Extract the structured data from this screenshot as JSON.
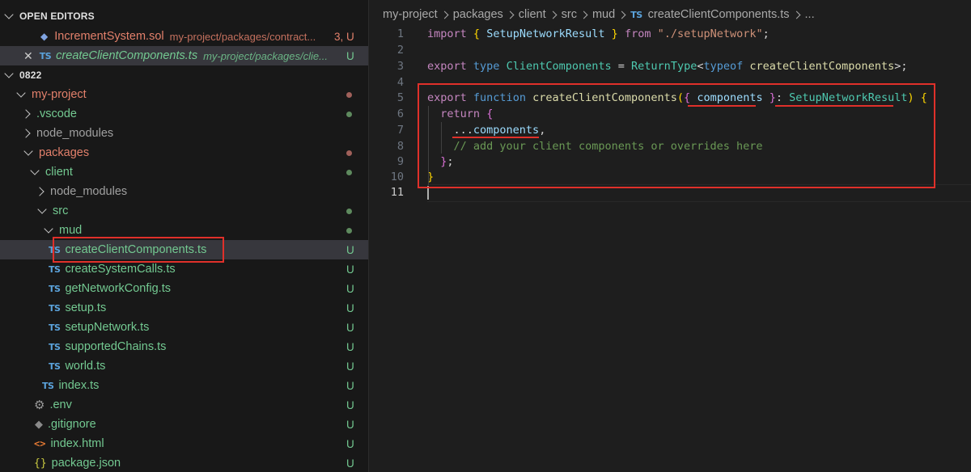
{
  "sidebar": {
    "open_editors_title": "OPEN EDITORS",
    "open_editors": [
      {
        "name": "IncrementSystem.sol",
        "path": "my-project/packages/contract...",
        "badge": "3, U"
      },
      {
        "name": "createClientComponents.ts",
        "path": "my-project/packages/clie...",
        "badge": "U",
        "icon": "TS"
      }
    ],
    "workspace_title": "0822",
    "tree": [
      {
        "label": "my-project"
      },
      {
        "label": ".vscode"
      },
      {
        "label": "node_modules"
      },
      {
        "label": "packages"
      },
      {
        "label": "client"
      },
      {
        "label": "node_modules"
      },
      {
        "label": "src"
      },
      {
        "label": "mud"
      },
      {
        "label": "createClientComponents.ts",
        "icon": "TS",
        "badge": "U"
      },
      {
        "label": "createSystemCalls.ts",
        "icon": "TS",
        "badge": "U"
      },
      {
        "label": "getNetworkConfig.ts",
        "icon": "TS",
        "badge": "U"
      },
      {
        "label": "setup.ts",
        "icon": "TS",
        "badge": "U"
      },
      {
        "label": "setupNetwork.ts",
        "icon": "TS",
        "badge": "U"
      },
      {
        "label": "supportedChains.ts",
        "icon": "TS",
        "badge": "U"
      },
      {
        "label": "world.ts",
        "icon": "TS",
        "badge": "U"
      },
      {
        "label": "index.ts",
        "icon": "TS",
        "badge": "U"
      },
      {
        "label": ".env",
        "badge": "U"
      },
      {
        "label": ".gitignore",
        "badge": "U"
      },
      {
        "label": "index.html",
        "icon": "<>",
        "badge": "U"
      },
      {
        "label": "package.json",
        "icon": "{}",
        "badge": "U"
      }
    ]
  },
  "editor": {
    "breadcrumb": [
      "my-project",
      "packages",
      "client",
      "src",
      "mud"
    ],
    "breadcrumb_file_icon": "TS",
    "breadcrumb_file": "createClientComponents.ts",
    "breadcrumb_more": "...",
    "line_numbers": [
      "1",
      "2",
      "3",
      "4",
      "5",
      "6",
      "7",
      "8",
      "9",
      "10",
      "11"
    ],
    "code": {
      "l1": {
        "import": "import",
        "ob": "{",
        "name": "SetupNetworkResult",
        "cb": "}",
        "from": "from",
        "str": "\"./setupNetwork\"",
        "semi": ";"
      },
      "l3": {
        "export": "export",
        "type": "type",
        "name": "ClientComponents",
        "eq": "=",
        "rt": "ReturnType",
        "lt": "<",
        "typeof": "typeof",
        "fn": "createClientComponents",
        "end": ">;"
      },
      "l5": {
        "export": "export",
        "function": "function",
        "fn": "createClientComponents",
        "op": "(",
        "ob": "{",
        "param": "components",
        "cb": "}",
        "colon": ":",
        "type": "SetupNetworkResult",
        "cp": ")",
        "body": "{"
      },
      "l6": {
        "return": "return",
        "ob": "{"
      },
      "l7": {
        "spread": "...",
        "name": "components",
        "comma": ","
      },
      "l8": {
        "comment": "// add your client components or overrides here"
      },
      "l9": {
        "cb": "}",
        "semi": ";"
      },
      "l10": {
        "cb": "}"
      }
    }
  },
  "colors": {
    "annotation_red": "#e0302a",
    "untracked_green": "#73c991",
    "error_orange": "#e2806b"
  }
}
